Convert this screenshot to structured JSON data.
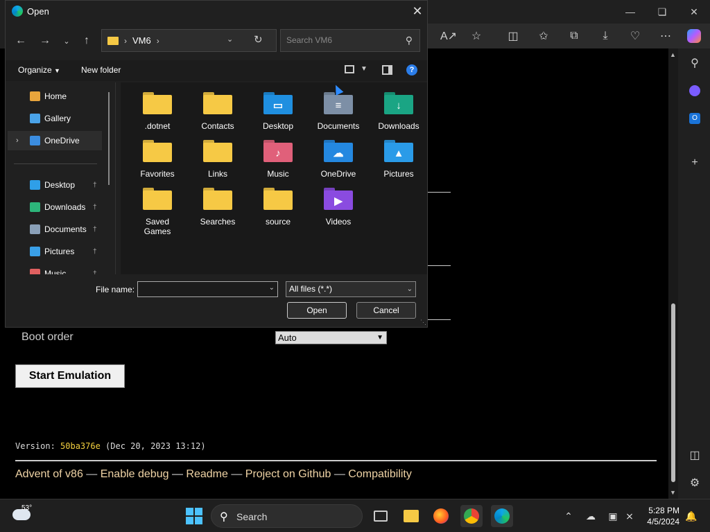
{
  "dialog": {
    "title": "Open",
    "path": [
      "VM6"
    ],
    "search_placeholder": "Search VM6",
    "organize_label": "Organize",
    "new_folder_label": "New folder",
    "nav_items": [
      {
        "label": "Home",
        "icon": "home-icon",
        "color": "#e8a53c"
      },
      {
        "label": "Gallery",
        "icon": "gallery-icon",
        "color": "#4aa3e8"
      },
      {
        "label": "OneDrive",
        "icon": "onedrive-icon",
        "color": "#3b8de0"
      },
      {
        "label": "Desktop",
        "icon": "desktop-icon",
        "color": "#2f9fe8",
        "pinned": true
      },
      {
        "label": "Downloads",
        "icon": "download-icon",
        "color": "#2db57a",
        "pinned": true
      },
      {
        "label": "Documents",
        "icon": "document-icon",
        "color": "#8aa0b8",
        "pinned": true
      },
      {
        "label": "Pictures",
        "icon": "picture-icon",
        "color": "#3aa0e8",
        "pinned": true
      },
      {
        "label": "Music",
        "icon": "music-icon",
        "color": "#e06060",
        "pinned": true
      }
    ],
    "files": [
      {
        "name": ".dotnet",
        "icon": "folder-icon",
        "color": "#f6c945"
      },
      {
        "name": "Contacts",
        "icon": "folder-icon",
        "color": "#f6c945"
      },
      {
        "name": "Desktop",
        "icon": "desktop-folder-icon",
        "color": "#1f8fe0"
      },
      {
        "name": "Documents",
        "icon": "documents-folder-icon",
        "color": "#7d8fa6"
      },
      {
        "name": "Downloads",
        "icon": "downloads-folder-icon",
        "color": "#1aa584"
      },
      {
        "name": "Favorites",
        "icon": "folder-icon",
        "color": "#f6c945"
      },
      {
        "name": "Links",
        "icon": "folder-icon",
        "color": "#f6c945"
      },
      {
        "name": "Music",
        "icon": "music-folder-icon",
        "color": "#e0607a"
      },
      {
        "name": "OneDrive",
        "icon": "onedrive-folder-icon",
        "color": "#2488e0"
      },
      {
        "name": "Pictures",
        "icon": "pictures-folder-icon",
        "color": "#2a9be8"
      },
      {
        "name": "Saved\nGames",
        "icon": "folder-icon",
        "color": "#f6c945"
      },
      {
        "name": "Searches",
        "icon": "folder-icon",
        "color": "#f6c945"
      },
      {
        "name": "source",
        "icon": "folder-icon",
        "color": "#f6c945"
      },
      {
        "name": "Videos",
        "icon": "videos-folder-icon",
        "color": "#8a4be0"
      }
    ],
    "file_name_label": "File name:",
    "file_name_value": "",
    "filter_value": "All files (*.*)",
    "open_label": "Open",
    "cancel_label": "Cancel"
  },
  "page": {
    "boot_order_label": "Boot order",
    "boot_order_value": "Auto",
    "start_button_label": "Start Emulation",
    "version_prefix": "Version: ",
    "version_hash": "50ba376e",
    "version_suffix": " (Dec 20, 2023 13:12)",
    "footer_links": [
      "Advent of v86",
      "Enable debug",
      "Readme",
      "Project on Github",
      "Compatibility"
    ],
    "footer_sep": " — "
  },
  "taskbar": {
    "weather_temp": "53°",
    "search_label": "Search",
    "time": "5:28 PM",
    "date": "4/5/2024"
  }
}
